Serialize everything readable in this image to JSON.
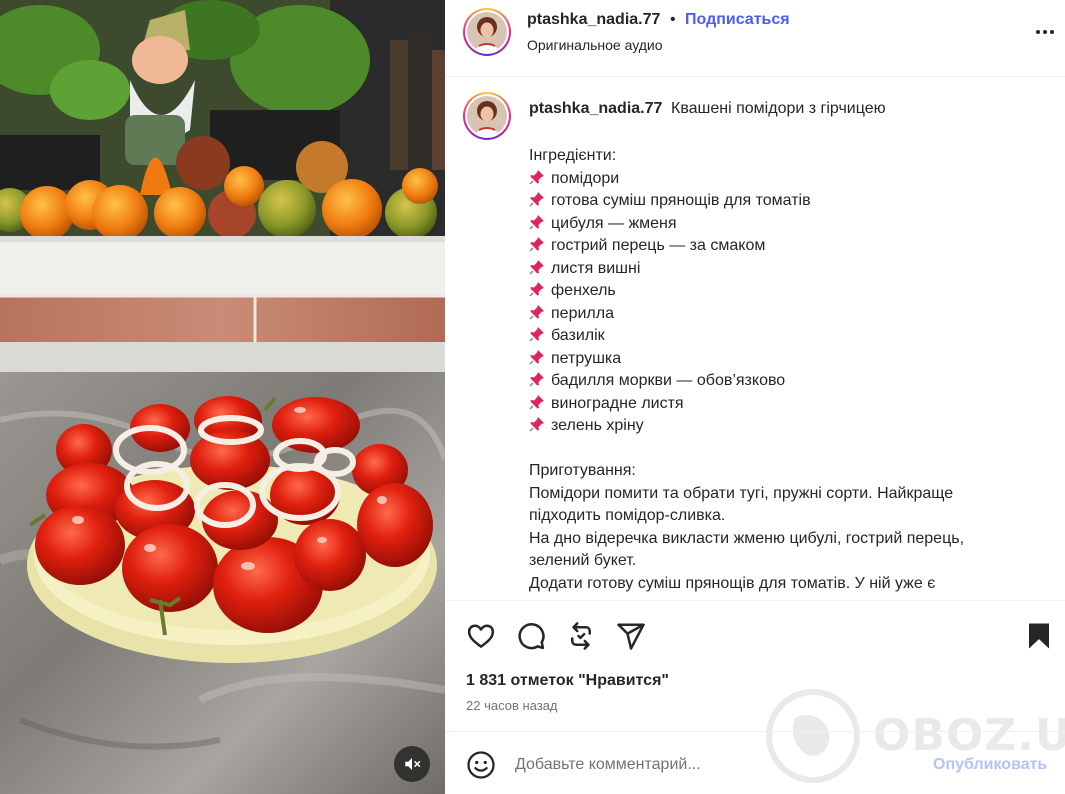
{
  "header": {
    "username": "ptashka_nadia.77",
    "separator": "•",
    "follow_label": "Подписаться",
    "audio_label": "Оригинальное аудио",
    "more_icon": "more-horizontal-icon"
  },
  "caption": {
    "username": "ptashka_nadia.77",
    "title": "Квашені помідори з гірчицею",
    "ingredients_heading": "Інгредієнти:",
    "pin_emoji": "📌",
    "ingredients": [
      "помідори",
      "готова суміш прянощів для томатів",
      "цибуля — жменя",
      "гострий перець — за смаком",
      "листя вишні",
      "фенхель",
      "перилла",
      "базилік",
      "петрушка",
      "бадилля моркви — обов’язково",
      "виноградне листя",
      "зелень хріну"
    ],
    "preparation_heading": "Приготування:",
    "preparation_lines": [
      "Помідори помити та обрати тугі, пружні сорти. Найкраще",
      "підходить помідор-сливка.",
      "На дно відеречка викласти жменю цибулі, гострий перець,",
      "зелений букет.",
      "Додати готову суміш прянощів для томатів. У ній уже є"
    ]
  },
  "actions": {
    "like_icon": "heart-icon",
    "comment_icon": "comment-icon",
    "repost_icon": "repost-icon",
    "share_icon": "send-icon",
    "save_icon": "bookmark-icon",
    "likes_text": "1 831 отметок \"Нравится\"",
    "time_text": "22 часов назад"
  },
  "comment": {
    "emoji_icon": "emoji-icon",
    "placeholder": "Добавьте комментарий...",
    "publish_label": "Опубликовать"
  },
  "media": {
    "mute_icon": "speaker-muted-icon"
  },
  "watermark": {
    "text": "OBOZ.UA"
  },
  "colors": {
    "accent": "#4a5df9",
    "publish_disabled": "#b3c3f7",
    "text": "#262626",
    "muted": "#737373",
    "divider": "#efefef"
  }
}
